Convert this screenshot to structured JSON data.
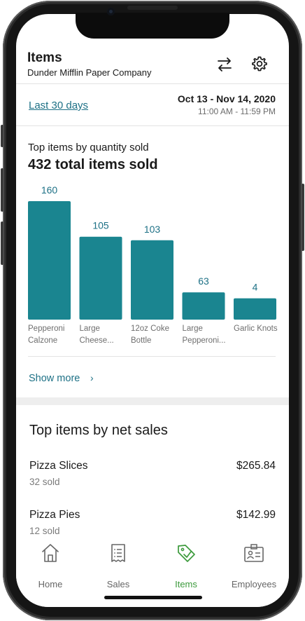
{
  "header": {
    "title": "Items",
    "subtitle": "Dunder Mifflin Paper Company",
    "swap_icon": "swap-arrows-icon",
    "settings_icon": "gear-icon"
  },
  "range": {
    "preset": "Last 30 days",
    "dates": "Oct 13 - Nov 14, 2020",
    "times": "11:00 AM - 11:59 PM"
  },
  "quantity": {
    "title": "Top items by quantity sold",
    "total": "432 total items sold",
    "show_more": "Show more",
    "chevron": "›"
  },
  "chart_data": {
    "type": "bar",
    "categories": [
      "Pepperoni Calzone",
      "Large Cheese...",
      "12oz Coke Bottle",
      "Large Pepperoni...",
      "Garlic Knots"
    ],
    "category_lines": [
      [
        "Pepperoni",
        "Calzone"
      ],
      [
        "Large",
        "Cheese..."
      ],
      [
        "12oz Coke",
        "Bottle"
      ],
      [
        "Large",
        "Pepperoni..."
      ],
      [
        "Garlic Knots"
      ]
    ],
    "values": [
      160,
      105,
      103,
      63,
      4
    ],
    "value_labels": [
      "160",
      "105",
      "103",
      "63",
      "4"
    ],
    "bar_heights_relative": [
      1.0,
      0.7,
      0.67,
      0.23,
      0.18
    ],
    "color": "#1a8590",
    "title": "",
    "xlabel": "",
    "ylabel": ""
  },
  "net_sales": {
    "title": "Top items by net sales",
    "rows": [
      {
        "name": "Pizza Slices",
        "sold": "32 sold",
        "amount": "$265.84"
      },
      {
        "name": "Pizza Pies",
        "sold": "12 sold",
        "amount": "$142.99"
      }
    ]
  },
  "tabs": [
    {
      "label": "Home",
      "icon": "home-icon",
      "active": false
    },
    {
      "label": "Sales",
      "icon": "receipt-icon",
      "active": false
    },
    {
      "label": "Items",
      "icon": "tag-icon",
      "active": true
    },
    {
      "label": "Employees",
      "icon": "id-badge-icon",
      "active": false
    }
  ],
  "colors": {
    "accent": "#1e7186",
    "bar": "#1a8590",
    "active_tab": "#3c9a3c"
  }
}
